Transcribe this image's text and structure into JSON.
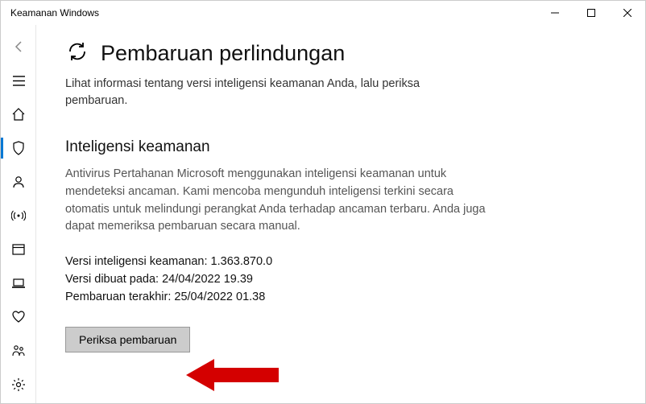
{
  "window": {
    "title": "Keamanan Windows"
  },
  "page": {
    "title": "Pembaruan perlindungan",
    "subtitle": "Lihat informasi tentang versi inteligensi keamanan Anda, lalu periksa pembaruan."
  },
  "section": {
    "title": "Inteligensi keamanan",
    "desc": "Antivirus Pertahanan Microsoft menggunakan inteligensi keamanan untuk mendeteksi ancaman. Kami mencoba mengunduh inteligensi terkini secara otomatis untuk melindungi perangkat Anda terhadap ancaman terbaru. Anda juga dapat memeriksa pembaruan secara manual.",
    "version_line": "Versi inteligensi keamanan: 1.363.870.0",
    "created_line": "Versi dibuat pada: 24/04/2022 19.39",
    "updated_line": "Pembaruan terakhir: 25/04/2022 01.38"
  },
  "buttons": {
    "check_updates": "Periksa pembaruan"
  }
}
